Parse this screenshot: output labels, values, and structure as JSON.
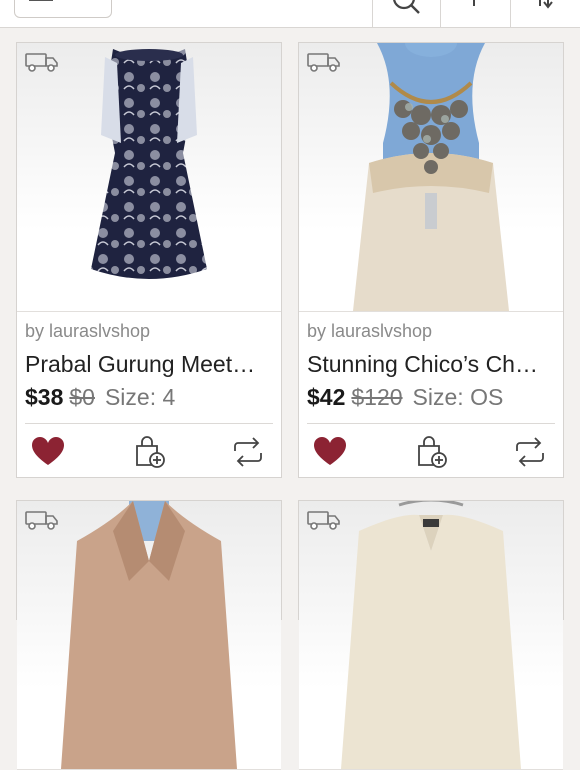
{
  "header": {
    "menu_icon": "hamburger-icon",
    "search_icon": "search-icon",
    "filter_icon": "filter-icon",
    "sort_icon": "sort-icon"
  },
  "listings": [
    {
      "seller": "by lauraslvshop",
      "title": "Prabal Gurung Meet…",
      "price": "$38",
      "original_price": "$0",
      "size": "Size: 4",
      "liked": true,
      "image": "navy floral sleeveless dress with white side panels"
    },
    {
      "seller": "by lauraslvshop",
      "title": "Stunning Chico’s Ch…",
      "price": "$42",
      "original_price": "$120",
      "size": "Size: OS",
      "liked": true,
      "image": "cream crochet top with shell statement necklace"
    },
    {
      "image": "tan leather jacket"
    },
    {
      "image": "cream textured jacket"
    }
  ],
  "colors": {
    "heart": "#8c2333",
    "icon": "#444444",
    "card_border": "#d6d3d0"
  }
}
